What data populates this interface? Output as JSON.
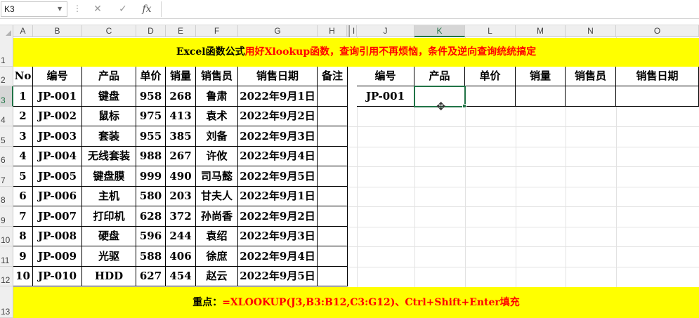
{
  "formula_bar": {
    "name_box": "K3",
    "cancel_icon": "✕",
    "enter_icon": "✓",
    "fx_label": "fx",
    "formula_value": ""
  },
  "columns": [
    "A",
    "B",
    "C",
    "D",
    "E",
    "F",
    "G",
    "H",
    "I",
    "J",
    "K",
    "L",
    "M",
    "N",
    "O"
  ],
  "selected_column": "K",
  "rows": [
    "1",
    "2",
    "3",
    "4",
    "5",
    "6",
    "7",
    "8",
    "9",
    "10",
    "11",
    "12",
    "13"
  ],
  "selected_row": "3",
  "title_banner": {
    "part1": "Excel函数公式",
    "part2": "用好Xlookup函数，查询引用不再烦恼，条件及逆向查询统统搞定"
  },
  "footer_banner": {
    "part1": "重点：",
    "part2": "=XLOOKUP(J3,B3:B12,C3:G12)、Ctrl+Shift+Enter填充"
  },
  "left_table": {
    "headers": [
      "No",
      "编号",
      "产品",
      "单价",
      "销量",
      "销售员",
      "销售日期",
      "备注"
    ],
    "rows": [
      [
        "1",
        "JP-001",
        "键盘",
        "958",
        "268",
        "鲁肃",
        "2022年9月1日",
        ""
      ],
      [
        "2",
        "JP-002",
        "鼠标",
        "975",
        "413",
        "袁术",
        "2022年9月2日",
        ""
      ],
      [
        "3",
        "JP-003",
        "套装",
        "955",
        "385",
        "刘备",
        "2022年9月3日",
        ""
      ],
      [
        "4",
        "JP-004",
        "无线套装",
        "988",
        "267",
        "许攸",
        "2022年9月4日",
        ""
      ],
      [
        "5",
        "JP-005",
        "键盘膜",
        "999",
        "490",
        "司马懿",
        "2022年9月5日",
        ""
      ],
      [
        "6",
        "JP-006",
        "主机",
        "580",
        "203",
        "甘夫人",
        "2022年9月1日",
        ""
      ],
      [
        "7",
        "JP-007",
        "打印机",
        "628",
        "372",
        "孙尚香",
        "2022年9月2日",
        ""
      ],
      [
        "8",
        "JP-008",
        "硬盘",
        "596",
        "244",
        "袁绍",
        "2022年9月3日",
        ""
      ],
      [
        "9",
        "JP-009",
        "光驱",
        "588",
        "406",
        "徐庶",
        "2022年9月4日",
        ""
      ],
      [
        "10",
        "JP-010",
        "HDD",
        "627",
        "454",
        "赵云",
        "2022年9月5日",
        ""
      ]
    ]
  },
  "right_table": {
    "headers": [
      "编号",
      "产品",
      "单价",
      "销量",
      "销售员",
      "销售日期"
    ],
    "row": [
      "JP-001",
      "",
      "",
      "",
      "",
      ""
    ]
  },
  "colors": {
    "banner_bg": "#ffff00",
    "highlight_text": "#ff0000",
    "selection": "#217346"
  }
}
